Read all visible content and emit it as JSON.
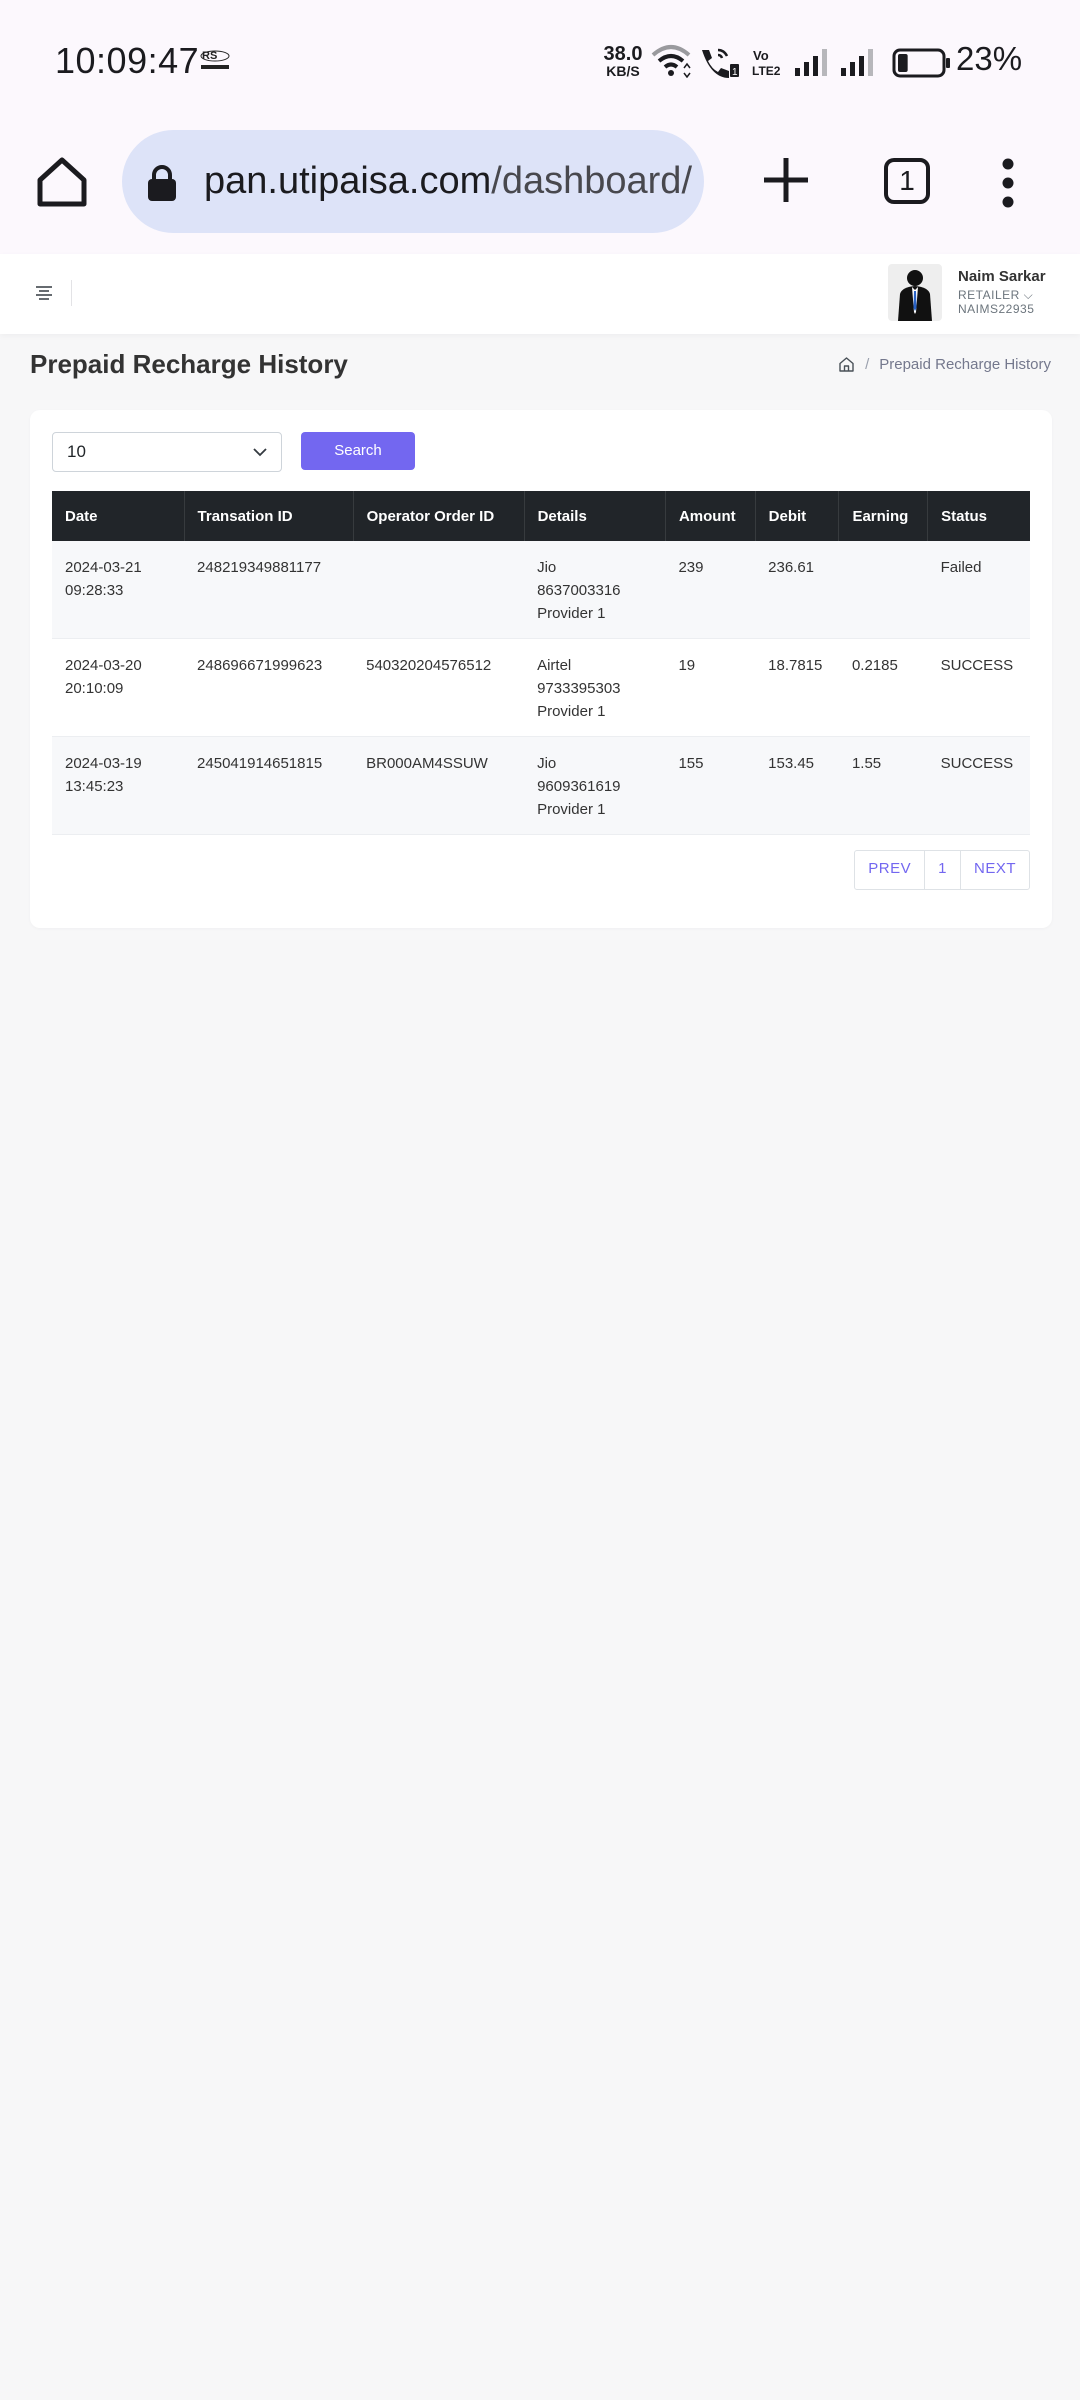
{
  "status_bar": {
    "time": "10:09:47",
    "net_speed_value": "38.0",
    "net_speed_unit": "KB/S",
    "volte_label": "Vo LTE2",
    "battery_percent": "23%",
    "battery_level": 0.23
  },
  "browser": {
    "url_host": "pan.utipaisa.com",
    "url_path": "/dashboard/",
    "tab_count": "1",
    "icons": [
      "home-icon",
      "lock-icon",
      "plus-icon",
      "tabs-icon",
      "more-vert-icon"
    ]
  },
  "header": {
    "user_name": "Naim Sarkar",
    "user_role": "RETAILER",
    "user_id": "NAIMS22935"
  },
  "page": {
    "title": "Prepaid Recharge History",
    "breadcrumb_current": "Prepaid Recharge History",
    "breadcrumb_sep": "/"
  },
  "controls": {
    "page_size": "10",
    "search_label": "Search"
  },
  "table": {
    "headers": [
      "Date",
      "Transation ID",
      "Operator Order ID",
      "Details",
      "Amount",
      "Debit",
      "Earning",
      "Status"
    ],
    "rows": [
      {
        "date": "2024-03-21",
        "time": "09:28:33",
        "txid": "248219349881177",
        "op_order_id": "",
        "operator": "Jio",
        "mobile": "8637003316",
        "provider": "Provider 1",
        "amount": "239",
        "debit": "236.61",
        "earning": "",
        "status": "Failed"
      },
      {
        "date": "2024-03-20",
        "time": "20:10:09",
        "txid": "248696671999623",
        "op_order_id": "540320204576512",
        "operator": "Airtel",
        "mobile": "9733395303",
        "provider": "Provider 1",
        "amount": "19",
        "debit": "18.7815",
        "earning": "0.2185",
        "status": "SUCCESS"
      },
      {
        "date": "2024-03-19",
        "time": "13:45:23",
        "txid": "245041914651815",
        "op_order_id": "BR000AM4SSUW",
        "operator": "Jio",
        "mobile": "9609361619",
        "provider": "Provider 1",
        "amount": "155",
        "debit": "153.45",
        "earning": "1.55",
        "status": "SUCCESS"
      }
    ]
  },
  "pagination": {
    "prev": "PREV",
    "current": "1",
    "next": "NEXT"
  },
  "colors": {
    "accent": "#7367f0",
    "table_header": "#212529",
    "url_bar": "#dde3f8"
  }
}
